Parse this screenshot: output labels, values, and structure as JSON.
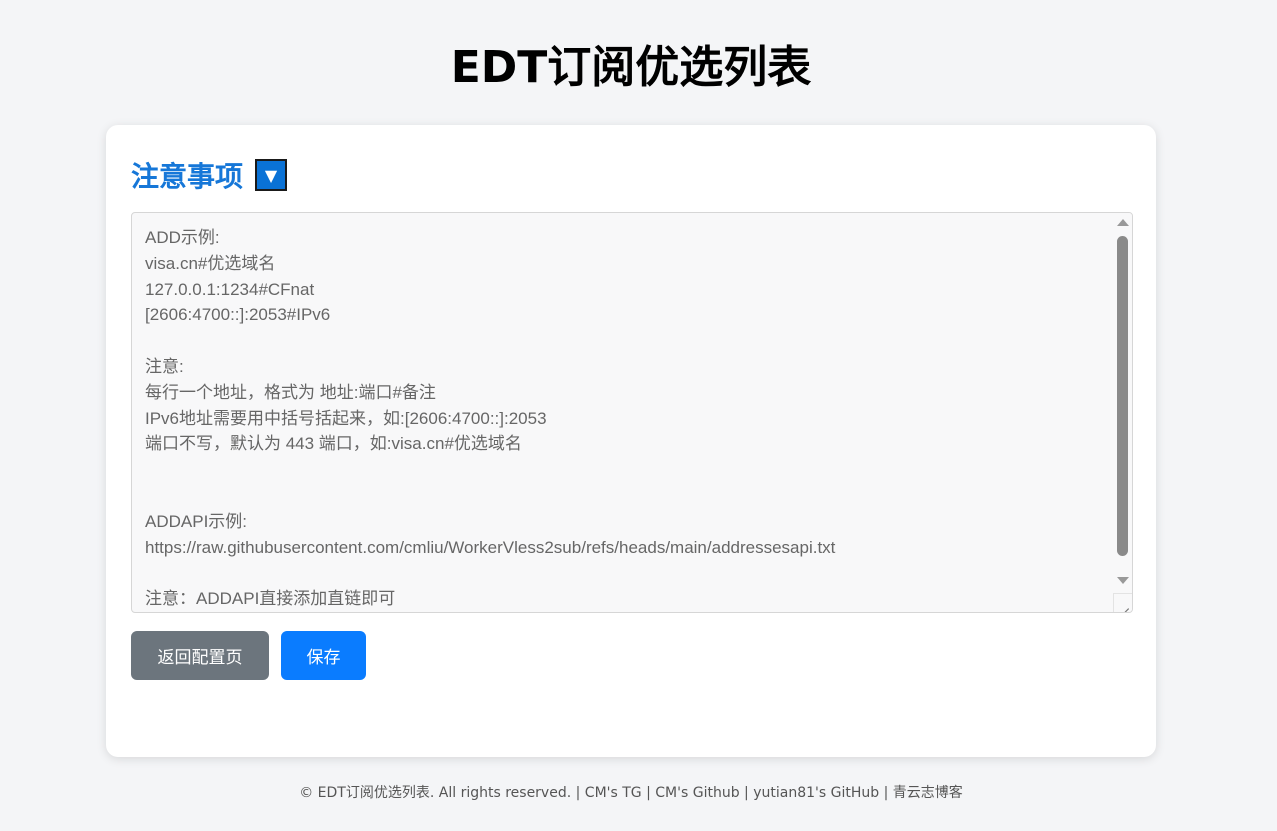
{
  "page": {
    "title": "EDT订阅优选列表"
  },
  "notice": {
    "title": "注意事项",
    "toggle_icon": "▼"
  },
  "editor": {
    "content": "ADD示例:\nvisa.cn#优选域名\n127.0.0.1:1234#CFnat\n[2606:4700::]:2053#IPv6\n\n注意:\n每行一个地址，格式为 地址:端口#备注\nIPv6地址需要用中括号括起来，如:[2606:4700::]:2053\n端口不写，默认为 443 端口，如:visa.cn#优选域名\n\n\nADDAPI示例:\nhttps://raw.githubusercontent.com/cmliu/WorkerVless2sub/refs/heads/main/addressesapi.txt\n\n注意：ADDAPI直接添加直链即可"
  },
  "buttons": {
    "back_label": "返回配置页",
    "save_label": "保存"
  },
  "footer": {
    "copyright": "© EDT订阅优选列表. All rights reserved.",
    "separator": " | ",
    "links": [
      "CM's TG",
      "CM's Github",
      "yutian81's GitHub",
      "青云志博客"
    ]
  },
  "colors": {
    "accent": "#1677d8",
    "save_button": "#0a7cff",
    "back_button": "#6c757d",
    "background": "#f4f5f7"
  }
}
